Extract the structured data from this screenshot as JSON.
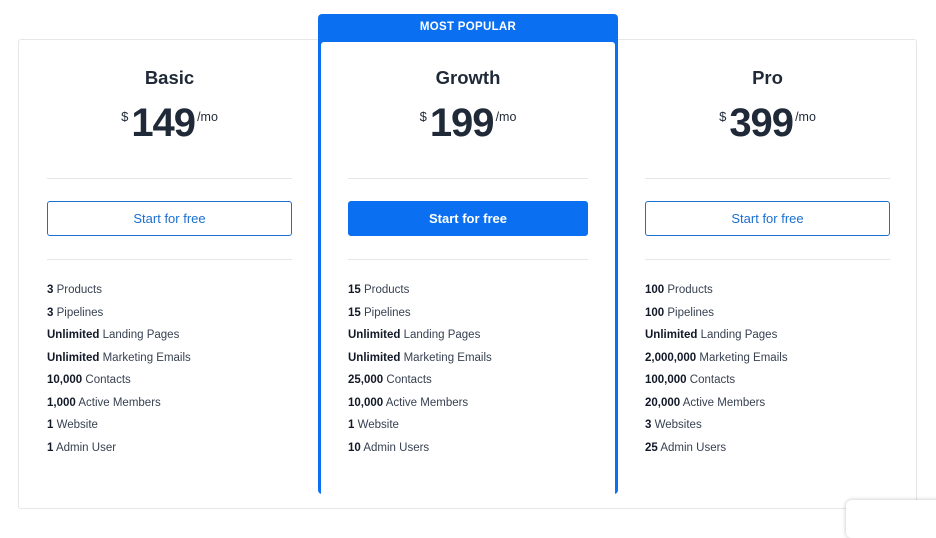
{
  "plans": [
    {
      "name": "Basic",
      "currency": "$",
      "amount": "149",
      "period": "/mo",
      "cta_label": "Start for free",
      "features": [
        {
          "value": "3",
          "label": "Products"
        },
        {
          "value": "3",
          "label": "Pipelines"
        },
        {
          "value": "Unlimited",
          "label": "Landing Pages"
        },
        {
          "value": "Unlimited",
          "label": "Marketing Emails"
        },
        {
          "value": "10,000",
          "label": "Contacts"
        },
        {
          "value": "1,000",
          "label": "Active Members"
        },
        {
          "value": "1",
          "label": "Website"
        },
        {
          "value": "1",
          "label": "Admin User"
        }
      ]
    },
    {
      "badge": "MOST POPULAR",
      "name": "Growth",
      "currency": "$",
      "amount": "199",
      "period": "/mo",
      "cta_label": "Start for free",
      "features": [
        {
          "value": "15",
          "label": "Products"
        },
        {
          "value": "15",
          "label": "Pipelines"
        },
        {
          "value": "Unlimited",
          "label": "Landing Pages"
        },
        {
          "value": "Unlimited",
          "label": "Marketing Emails"
        },
        {
          "value": "25,000",
          "label": "Contacts"
        },
        {
          "value": "10,000",
          "label": "Active Members"
        },
        {
          "value": "1",
          "label": "Website"
        },
        {
          "value": "10",
          "label": "Admin Users"
        }
      ]
    },
    {
      "name": "Pro",
      "currency": "$",
      "amount": "399",
      "period": "/mo",
      "cta_label": "Start for free",
      "features": [
        {
          "value": "100",
          "label": "Products"
        },
        {
          "value": "100",
          "label": "Pipelines"
        },
        {
          "value": "Unlimited",
          "label": "Landing Pages"
        },
        {
          "value": "2,000,000",
          "label": "Marketing Emails"
        },
        {
          "value": "100,000",
          "label": "Contacts"
        },
        {
          "value": "20,000",
          "label": "Active Members"
        },
        {
          "value": "3",
          "label": "Websites"
        },
        {
          "value": "25",
          "label": "Admin Users"
        }
      ]
    }
  ],
  "colors": {
    "accent": "#0a6ff0",
    "outline_button": "#1b6fd1",
    "text_dark": "#1f2937",
    "divider": "#e5e7eb"
  }
}
